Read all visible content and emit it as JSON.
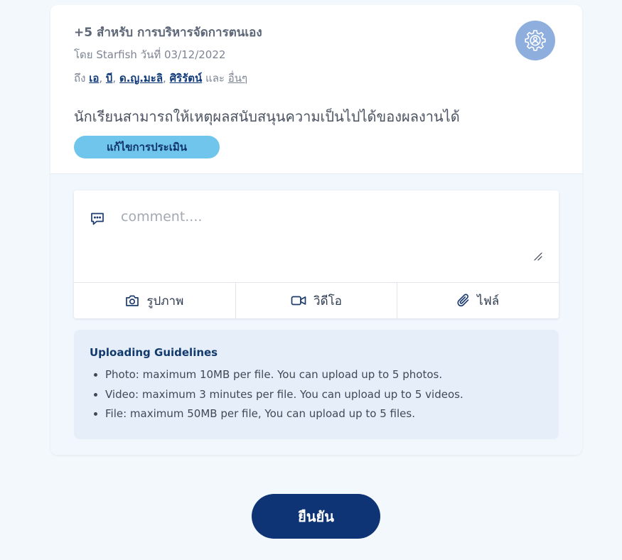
{
  "post": {
    "title": "+5 สำหรับ การบริหารจัดการตนเอง",
    "byline": "โดย Starfish วันที่ 03/12/2022",
    "recipients_prefix": "ถึง",
    "recipients": [
      "เอ",
      "บี",
      "ด.ญ.มะลิ",
      "ศิริรัตน์"
    ],
    "recipients_conjunction": "และ",
    "recipients_more": "อื่นๆ",
    "statement": "นักเรียนสามารถให้เหตุผลสนับสนุนความเป็นไปได้ของผลงานได้",
    "edit_label": "แก้ไขการประเมิน",
    "settings_icon": "gear-icon"
  },
  "comment": {
    "placeholder": "comment....",
    "value": "",
    "icon": "chat-bubble-icon"
  },
  "uploads": [
    {
      "label": "รูปภาพ",
      "icon": "camera-icon"
    },
    {
      "label": "วิดีโอ",
      "icon": "video-icon"
    },
    {
      "label": "ไฟล์",
      "icon": "paperclip-icon"
    }
  ],
  "guidelines": {
    "title": "Uploading Guidelines",
    "items": [
      "Photo: maximum 10MB per file. You can upload up to 5 photos.",
      "Video: maximum 3 minutes per file. You can upload up to 5 videos.",
      "File: maximum 50MB per file, You can upload up to 5 files."
    ]
  },
  "confirm_label": "ยืนยัน",
  "colors": {
    "accent_dark": "#0e3476",
    "accent_light": "#6fc5ec",
    "settings_bg": "#8eaede",
    "page_bg": "#f3f8fc",
    "guidelines_bg": "#e6eff9"
  }
}
